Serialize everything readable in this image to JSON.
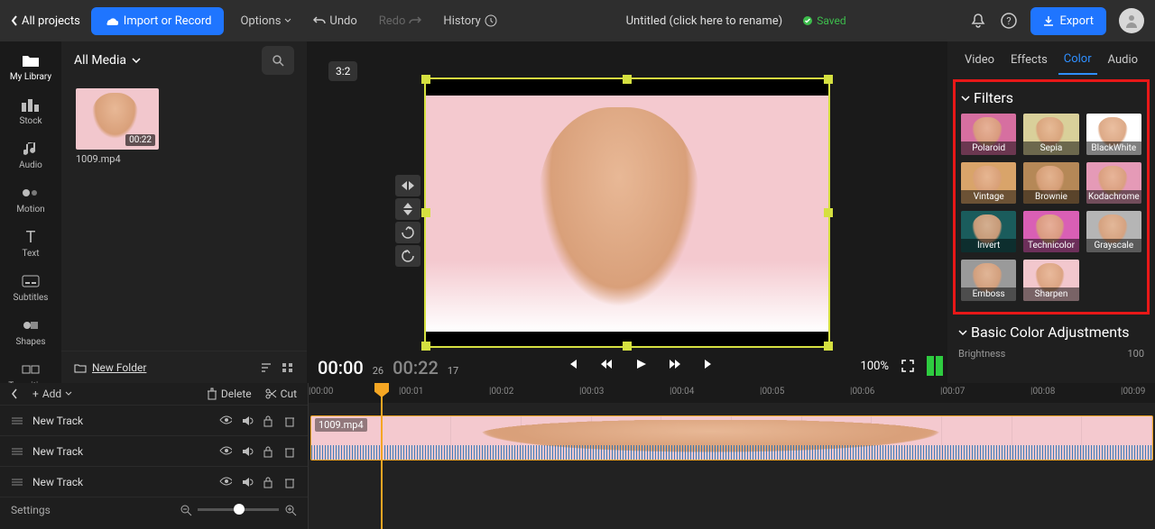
{
  "topbar": {
    "back": "All projects",
    "import": "Import or Record",
    "options": "Options",
    "undo": "Undo",
    "redo": "Redo",
    "history": "History",
    "title": "Untitled (click here to rename)",
    "saved": "Saved",
    "export": "Export"
  },
  "sidebar": {
    "items": [
      {
        "label": "My Library"
      },
      {
        "label": "Stock"
      },
      {
        "label": "Audio"
      },
      {
        "label": "Motion"
      },
      {
        "label": "Text"
      },
      {
        "label": "Subtitles"
      },
      {
        "label": "Shapes"
      },
      {
        "label": "Transitions"
      }
    ]
  },
  "media": {
    "select": "All Media",
    "thumb_duration": "00:22",
    "thumb_name": "1009.mp4",
    "new_folder": "New Folder"
  },
  "preview": {
    "ratio": "3:2"
  },
  "playback": {
    "current": "00:00",
    "current_frames": "26",
    "total": "00:22",
    "total_frames": "17",
    "zoom": "100%"
  },
  "right_panel": {
    "tabs": [
      "Video",
      "Effects",
      "Color",
      "Audio"
    ],
    "active_tab": 2,
    "filters_title": "Filters",
    "filters": [
      "Polaroid",
      "Sepia",
      "BlackWhite",
      "Vintage",
      "Brownie",
      "Kodachrome",
      "Invert",
      "Technicolor",
      "Grayscale",
      "Emboss",
      "Sharpen"
    ],
    "filter_tints": [
      "#d66fa0",
      "#d9d09a",
      "#ffffff",
      "#d9a46a",
      "#b58857",
      "#e59ab7",
      "#1a5c5c",
      "#d95fb5",
      "#b5b5b5",
      "#9a9a9a",
      "#f2c7cd"
    ],
    "adjustments_title": "Basic Color Adjustments",
    "brightness_label": "Brightness",
    "brightness_value": "100"
  },
  "tracks": {
    "add": "Add",
    "delete": "Delete",
    "cut": "Cut",
    "rows": [
      "New Track",
      "New Track",
      "New Track"
    ],
    "settings": "Settings",
    "back_icon": "<"
  },
  "timeline": {
    "ticks": [
      "|00:00",
      "|00:01",
      "|00:02",
      "|00:03",
      "|00:04",
      "|00:05",
      "|00:06",
      "|00:07",
      "|00:08",
      "|00:09"
    ],
    "clip_name": "1009.mp4"
  }
}
